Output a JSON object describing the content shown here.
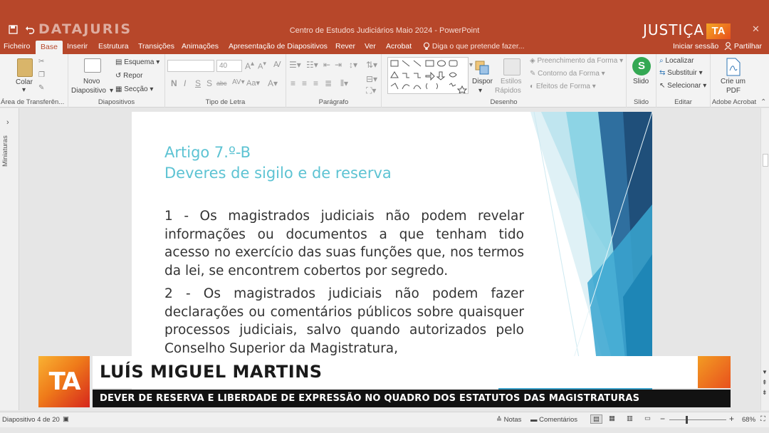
{
  "window": {
    "brand_watermark": "DATAJURIS",
    "document_title": "Centro de Estudos Judiciários Maio 2024 - PowerPoint",
    "channel_logo_text": "JUSTIÇA",
    "channel_logo_badge": "TA",
    "close_glyph": "✕"
  },
  "tabs": [
    {
      "label": "Ficheiro"
    },
    {
      "label": "Base"
    },
    {
      "label": "Inserir"
    },
    {
      "label": "Estrutura"
    },
    {
      "label": "Transições"
    },
    {
      "label": "Animações"
    },
    {
      "label": "Apresentação de Diapositivos"
    },
    {
      "label": "Rever"
    },
    {
      "label": "Ver"
    },
    {
      "label": "Acrobat"
    }
  ],
  "tell_me": "Diga o que pretende fazer...",
  "sign_in": "Iniciar sessão",
  "share": "Partilhar",
  "ribbon": {
    "clipboard": {
      "paste": "Colar",
      "label": "Área de Transferên..."
    },
    "slides": {
      "new_slide_1": "Novo",
      "new_slide_2": "Diapositivo",
      "layout": "Esquema",
      "reset": "Repor",
      "section": "Secção",
      "label": "Diapositivos"
    },
    "font": {
      "font_name": "",
      "font_size": "40",
      "label": "Tipo de Letra"
    },
    "paragraph": {
      "label": "Parágrafo"
    },
    "drawing": {
      "arrange": "Dispor",
      "quick_styles_1": "Estilos",
      "quick_styles_2": "Rápidos",
      "fill": "Preenchimento da Forma",
      "outline": "Contorno da Forma",
      "effects": "Efeitos de Forma",
      "label": "Desenho"
    },
    "slido": {
      "name": "Slido",
      "label": "Slido",
      "badge": "S"
    },
    "editing": {
      "find": "Localizar",
      "replace": "Substituir",
      "select": "Selecionar",
      "label": "Editar"
    },
    "acrobat": {
      "create_1": "Crie um",
      "create_2": "PDF",
      "label": "Adobe Acrobat"
    }
  },
  "left_pane": {
    "label": "Miniaturas"
  },
  "slide": {
    "title_line1": "Artigo 7.º-B",
    "title_line2": "Deveres de sigilo e de reserva",
    "para1": "1 - Os magistrados judiciais não podem revelar informações ou documentos a que tenham tido acesso no exercício das suas funções que, nos termos da lei, se encontrem cobertos por segredo.",
    "para2": "2 - Os magistrados judiciais não podem fazer declarações ou comentários públicos sobre quaisquer processos judiciais, salvo quando autorizados pelo Conselho Superior da Magistratura,"
  },
  "lower_third": {
    "logo": "TA",
    "name": "LUÍS MIGUEL MARTINS",
    "subtitle": "DEVER DE RESERVA E LIBERDADE DE EXPRESSÃO NO QUADRO DOS ESTATUTOS DAS MAGISTRATURAS"
  },
  "status": {
    "slide_counter": "Diapositivo 4 de 20",
    "notes": "Notas",
    "comments": "Comentários",
    "zoom": "68%"
  },
  "colors": {
    "accent": "#b7472a",
    "title_teal": "#5dc3d3",
    "deco_blue": "#2e75b6"
  }
}
